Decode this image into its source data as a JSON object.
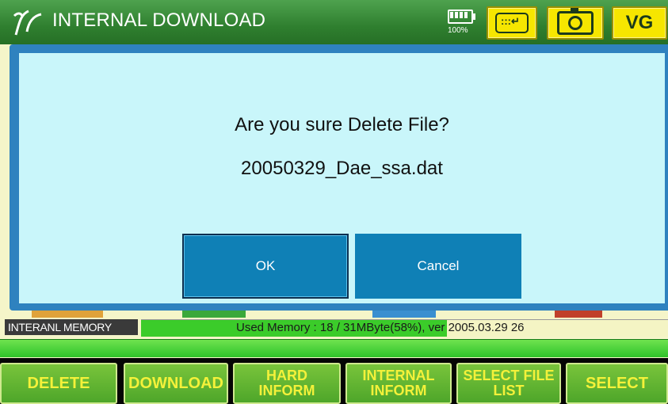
{
  "titlebar": {
    "title": "INTERNAL DOWNLOAD",
    "battery_percent": "100%",
    "battery_icon": "battery-icon",
    "vg_label": "VG"
  },
  "dialog": {
    "question": "Are you sure Delete File?",
    "filename": "20050329_Dae_ssa.dat",
    "ok_label": "OK",
    "cancel_label": "Cancel"
  },
  "memory": {
    "label": "INTERANL MEMORY",
    "status_text": "Used Memory : 18 / 31MByte(58%), ver 2005.03.29 26",
    "used_fraction": 0.58
  },
  "softkeys": {
    "delete": "DELETE",
    "download": "DOWNLOAD",
    "hard_inform_1": "HARD",
    "hard_inform_2": "INFORM",
    "internal_inform_1": "INTERNAL",
    "internal_inform_2": "INFORM",
    "select_file_list_1": "SELECT FILE",
    "select_file_list_2": "LIST",
    "select": "SELECT"
  },
  "colors": {
    "titlebar": "#2f7f2f",
    "accent_yellow": "#f6e600",
    "dialog_border": "#2f82bf",
    "dialog_body": "#c9f6fa",
    "button_blue": "#0f80b6",
    "softkey_text": "#f4f13a"
  }
}
